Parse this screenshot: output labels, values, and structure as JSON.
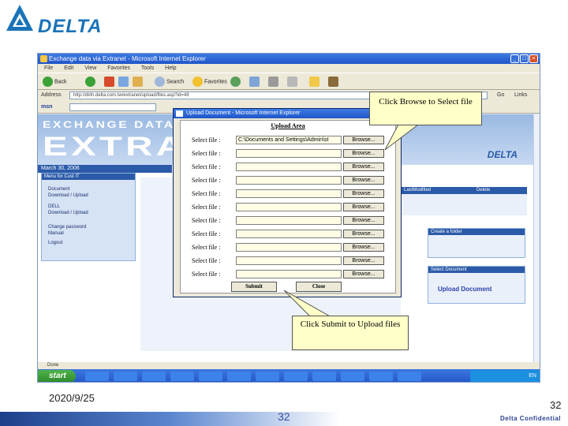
{
  "logo": {
    "text": "DELTA",
    "brand_color": "#1a73b8"
  },
  "browser": {
    "title": "Exchange data via Extranet - Microsoft Internet Explorer",
    "menu": [
      "File",
      "Edit",
      "View",
      "Favorites",
      "Tools",
      "Help"
    ],
    "toolbar": {
      "back": "Back",
      "search": "Search",
      "favorites": "Favorites"
    },
    "address_label": "Address",
    "address": "http://dkfn.delta.com.tw/extranet/upload/files.asp?id=49",
    "go": "Go",
    "links": "Links",
    "msn": "msn",
    "status": "Done"
  },
  "site": {
    "banner_line1": "EXCHANGE DATA VIA",
    "banner_line2": "EXTRANET",
    "banner_logo": "DELTA",
    "date": "March 30, 2006",
    "menu_header": "Menu for Cust IT",
    "menu_items": [
      "Document",
      "Download / Upload",
      "DELL",
      "Download / Upload",
      "Change password",
      "Manual",
      "Logout"
    ],
    "table_headers": [
      "LastModified",
      "Delete"
    ],
    "panel1_header": "Create a folder",
    "panel2_header": "Select Document",
    "upload_link": "Upload Document"
  },
  "dialog": {
    "title": "Upload Document - Microsoft Internet Explorer",
    "heading": "Upload Area",
    "row_label": "Select file :",
    "rows": [
      {
        "value": "C:\\Documents and Settings\\Admin\\st",
        "browse": "Browse..."
      },
      {
        "value": "",
        "browse": "Browse..."
      },
      {
        "value": "",
        "browse": "Browse..."
      },
      {
        "value": "",
        "browse": "Browse..."
      },
      {
        "value": "",
        "browse": "Browse..."
      },
      {
        "value": "",
        "browse": "Browse..."
      },
      {
        "value": "",
        "browse": "Browse..."
      },
      {
        "value": "",
        "browse": "Browse..."
      },
      {
        "value": "",
        "browse": "Browse..."
      },
      {
        "value": "",
        "browse": "Browse..."
      },
      {
        "value": "",
        "browse": "Browse..."
      }
    ],
    "submit": "Submit",
    "close": "Close"
  },
  "taskbar": {
    "start": "start",
    "clock": "EN"
  },
  "callouts": {
    "browse": "Click Browse to Select file",
    "submit": "Click Submit to Upload files"
  },
  "slide": {
    "date": "2020/9/25",
    "footer_number": "32",
    "page_number": "32",
    "confidential": "Delta Confidential"
  }
}
